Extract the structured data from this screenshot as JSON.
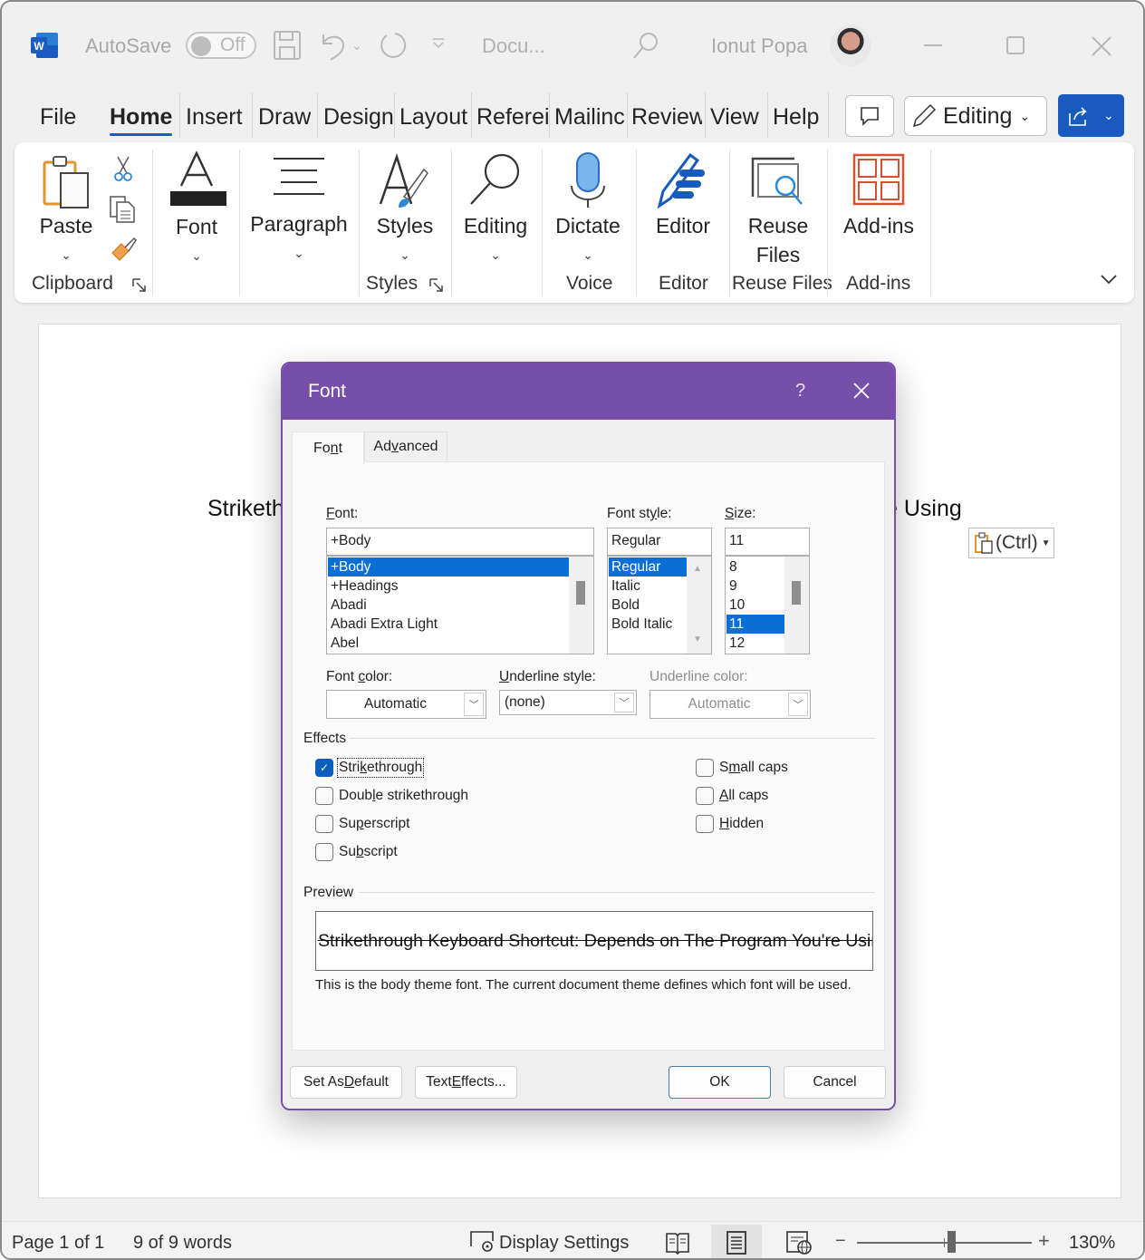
{
  "titlebar": {
    "app_icon_letter": "W",
    "autosave_label": "AutoSave",
    "autosave_state": "Off",
    "document_title": "Docu...",
    "user_name": "Ionut Popa",
    "icons": [
      "save-icon",
      "undo-icon",
      "redo-icon",
      "customize-qat-icon",
      "search-icon",
      "minimize-icon",
      "maximize-icon",
      "close-icon"
    ]
  },
  "menu": {
    "tabs": [
      {
        "label": "File",
        "active": false
      },
      {
        "label": "Home",
        "active": true
      },
      {
        "label": "Insert",
        "active": false
      },
      {
        "label": "Draw",
        "active": false
      },
      {
        "label": "Design",
        "active": false
      },
      {
        "label": "Layout",
        "active": false
      },
      {
        "label": "Referei",
        "active": false
      },
      {
        "label": "Mailinc",
        "active": false
      },
      {
        "label": "Review",
        "active": false
      },
      {
        "label": "View",
        "active": false
      },
      {
        "label": "Help",
        "active": false
      }
    ],
    "editing_label": "Editing"
  },
  "ribbon": {
    "paste_label": "Paste",
    "clipboard_group": "Clipboard",
    "font_label": "Font",
    "paragraph_label": "Paragraph",
    "styles_label": "Styles",
    "styles_group": "Styles",
    "editing_label": "Editing",
    "dictate_label": "Dictate",
    "voice_group": "Voice",
    "editor_label": "Editor",
    "editor_group": "Editor",
    "reuse_label_1": "Reuse",
    "reuse_label_2": "Files",
    "reuse_group": "Reuse Files",
    "addins_label": "Add-ins",
    "addins_group": "Add-ins"
  },
  "document": {
    "text_left": "Striketh",
    "text_right": "e Using",
    "paste_options_label": "(Ctrl)"
  },
  "dialog": {
    "title": "Font",
    "help": "?",
    "tabs": [
      {
        "label_pre": "Fo",
        "label_u": "n",
        "label_post": "t",
        "active": true
      },
      {
        "label_pre": "Ad",
        "label_u": "v",
        "label_post": "anced",
        "active": false
      }
    ],
    "font": {
      "label_u": "F",
      "label_rest": "ont:",
      "value": "+Body",
      "items": [
        "+Body",
        "+Headings",
        "Abadi",
        "Abadi Extra Light",
        "Abel"
      ],
      "selected": "+Body"
    },
    "font_style": {
      "label_pre": "Font st",
      "label_u": "y",
      "label_post": "le:",
      "value": "Regular",
      "items": [
        "Regular",
        "Italic",
        "Bold",
        "Bold Italic"
      ],
      "selected": "Regular"
    },
    "size": {
      "label_u": "S",
      "label_rest": "ize:",
      "value": "11",
      "items": [
        "8",
        "9",
        "10",
        "11",
        "12"
      ],
      "selected": "11"
    },
    "font_color": {
      "label_pre": "Font ",
      "label_u": "c",
      "label_post": "olor:",
      "value": "Automatic"
    },
    "underline_style": {
      "label_u": "U",
      "label_rest": "nderline style:",
      "value": "(none)"
    },
    "underline_color": {
      "label": "Underline color:",
      "value": "Automatic",
      "disabled": true
    },
    "effects_label": "Effects",
    "effects_left": [
      {
        "pre": "Stri",
        "u": "k",
        "post": "ethrough",
        "checked": true
      },
      {
        "pre": "Doub",
        "u": "l",
        "post": "e strikethrough",
        "checked": false
      },
      {
        "pre": "Su",
        "u": "p",
        "post": "erscript",
        "checked": false
      },
      {
        "pre": "Su",
        "u": "b",
        "post": "script",
        "checked": false
      }
    ],
    "effects_right": [
      {
        "pre": "S",
        "u": "m",
        "post": "all caps",
        "checked": false
      },
      {
        "pre": "",
        "u": "A",
        "post": "ll caps",
        "checked": false
      },
      {
        "pre": "",
        "u": "H",
        "post": "idden",
        "checked": false
      }
    ],
    "preview_label": "Preview",
    "preview_text": "Strikethrough Keyboard Shortcut: Depends on The Program You're Using",
    "preview_note": "This is the body theme font. The current document theme defines which font will be used.",
    "buttons": {
      "set_default": {
        "pre": "Set As ",
        "u": "D",
        "post": "efault"
      },
      "text_effects": {
        "pre": "Text ",
        "u": "E",
        "post": "ffects..."
      },
      "ok": "OK",
      "cancel": "Cancel"
    }
  },
  "statusbar": {
    "page": "Page 1 of 1",
    "words": "9 of 9 words",
    "display_settings": "Display Settings",
    "zoom_percent": "130%",
    "zoom_value": 130,
    "active_view": "print-layout"
  },
  "colors": {
    "accent": "#185abd",
    "dialog_title": "#774ea8",
    "selection": "#0b6fd6"
  }
}
